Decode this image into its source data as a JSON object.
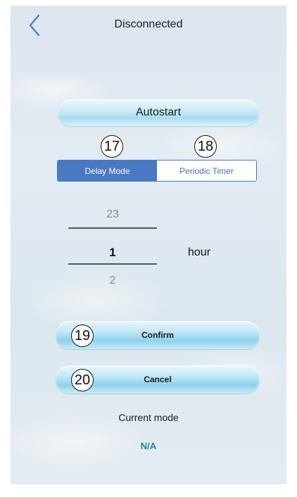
{
  "header": {
    "title": "Disconnected",
    "back_icon": "chevron-left-icon"
  },
  "autostart": {
    "label": "Autostart"
  },
  "annotations": [
    "17",
    "18",
    "19",
    "20"
  ],
  "mode_tabs": [
    {
      "label": "Delay Mode",
      "active": true
    },
    {
      "label": "Periodic Timer",
      "active": false
    }
  ],
  "picker": {
    "previous": "23",
    "selected": "1",
    "next": "2",
    "unit": "hour"
  },
  "actions": {
    "confirm_label": "Confirm",
    "cancel_label": "Cancel"
  },
  "status": {
    "label": "Current mode",
    "value": "N/A"
  },
  "colors": {
    "accent_blue": "#4a78c2",
    "back_icon": "#3e7bd1",
    "status_value": "#1f8a8a"
  }
}
